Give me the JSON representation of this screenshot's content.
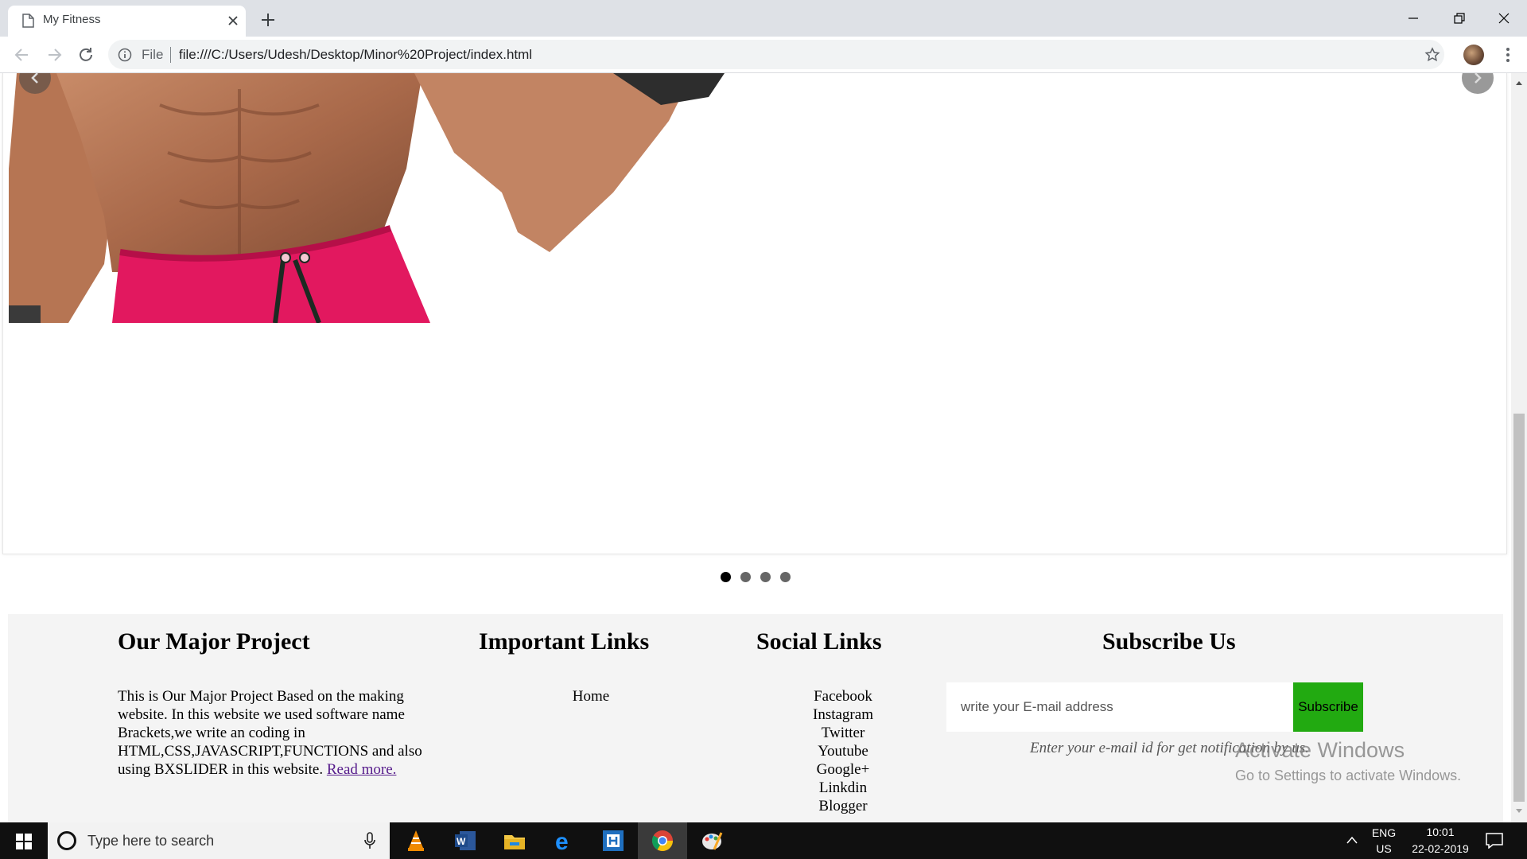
{
  "browser": {
    "tab_title": "My Fitness",
    "new_tab_symbol": "+",
    "omnibox_scheme": "File",
    "url": "file:///C:/Users/Udesh/Desktop/Minor%20Project/index.html"
  },
  "slider": {
    "pager_dots": 4,
    "active_dot": 1
  },
  "footer": {
    "about": {
      "heading": "Our Major Project",
      "text": "This is Our Major Project Based on the making website. In this website we used software name Brackets,we write an coding in HTML,CSS,JAVASCRIPT,FUNCTIONS and also using BXSLIDER in this website.",
      "read_more": "Read more."
    },
    "important_links": {
      "heading": "Important Links",
      "items": [
        "Home"
      ]
    },
    "social_links": {
      "heading": "Social Links",
      "items": [
        "Facebook",
        "Instagram",
        "Twitter",
        "Youtube",
        "Google+",
        "Linkdin",
        "Blogger"
      ]
    },
    "subscribe": {
      "heading": "Subscribe Us",
      "placeholder": "write your E-mail address",
      "button": "Subscribe",
      "note": "Enter your e-mail id for get notification by us.",
      "button_color": "#22aa11"
    }
  },
  "watermark": {
    "title": "Activate Windows",
    "subtitle": "Go to Settings to activate Windows."
  },
  "taskbar": {
    "search_placeholder": "Type here to search",
    "apps": [
      "vlc-icon",
      "word-icon",
      "file-explorer-icon",
      "edge-icon",
      "store-app-icon",
      "chrome-icon",
      "paint-icon"
    ],
    "language": "ENG",
    "region": "US",
    "time": "10:01",
    "date": "22-02-2019"
  }
}
